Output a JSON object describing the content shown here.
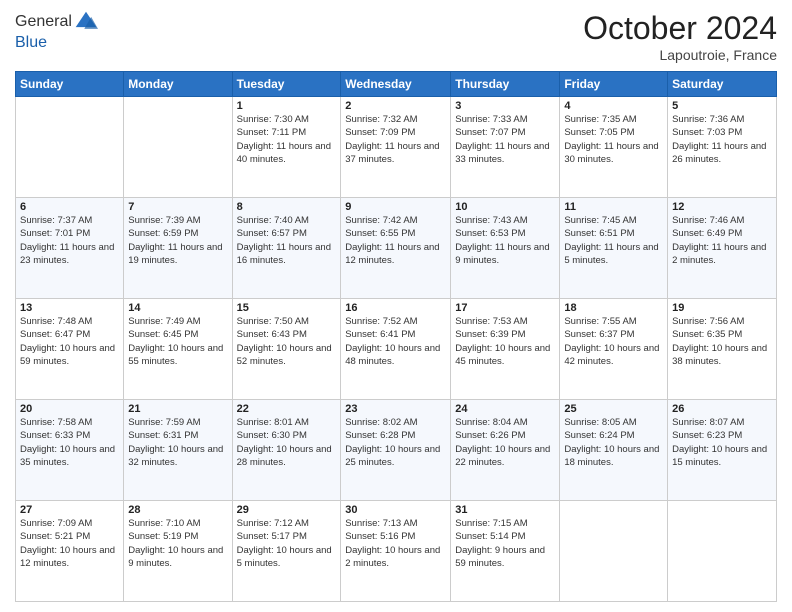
{
  "header": {
    "logo_line1": "General",
    "logo_line2": "Blue",
    "month_title": "October 2024",
    "location": "Lapoutroie, France"
  },
  "weekdays": [
    "Sunday",
    "Monday",
    "Tuesday",
    "Wednesday",
    "Thursday",
    "Friday",
    "Saturday"
  ],
  "weeks": [
    [
      {
        "day": "",
        "sunrise": "",
        "sunset": "",
        "daylight": ""
      },
      {
        "day": "",
        "sunrise": "",
        "sunset": "",
        "daylight": ""
      },
      {
        "day": "1",
        "sunrise": "Sunrise: 7:30 AM",
        "sunset": "Sunset: 7:11 PM",
        "daylight": "Daylight: 11 hours and 40 minutes."
      },
      {
        "day": "2",
        "sunrise": "Sunrise: 7:32 AM",
        "sunset": "Sunset: 7:09 PM",
        "daylight": "Daylight: 11 hours and 37 minutes."
      },
      {
        "day": "3",
        "sunrise": "Sunrise: 7:33 AM",
        "sunset": "Sunset: 7:07 PM",
        "daylight": "Daylight: 11 hours and 33 minutes."
      },
      {
        "day": "4",
        "sunrise": "Sunrise: 7:35 AM",
        "sunset": "Sunset: 7:05 PM",
        "daylight": "Daylight: 11 hours and 30 minutes."
      },
      {
        "day": "5",
        "sunrise": "Sunrise: 7:36 AM",
        "sunset": "Sunset: 7:03 PM",
        "daylight": "Daylight: 11 hours and 26 minutes."
      }
    ],
    [
      {
        "day": "6",
        "sunrise": "Sunrise: 7:37 AM",
        "sunset": "Sunset: 7:01 PM",
        "daylight": "Daylight: 11 hours and 23 minutes."
      },
      {
        "day": "7",
        "sunrise": "Sunrise: 7:39 AM",
        "sunset": "Sunset: 6:59 PM",
        "daylight": "Daylight: 11 hours and 19 minutes."
      },
      {
        "day": "8",
        "sunrise": "Sunrise: 7:40 AM",
        "sunset": "Sunset: 6:57 PM",
        "daylight": "Daylight: 11 hours and 16 minutes."
      },
      {
        "day": "9",
        "sunrise": "Sunrise: 7:42 AM",
        "sunset": "Sunset: 6:55 PM",
        "daylight": "Daylight: 11 hours and 12 minutes."
      },
      {
        "day": "10",
        "sunrise": "Sunrise: 7:43 AM",
        "sunset": "Sunset: 6:53 PM",
        "daylight": "Daylight: 11 hours and 9 minutes."
      },
      {
        "day": "11",
        "sunrise": "Sunrise: 7:45 AM",
        "sunset": "Sunset: 6:51 PM",
        "daylight": "Daylight: 11 hours and 5 minutes."
      },
      {
        "day": "12",
        "sunrise": "Sunrise: 7:46 AM",
        "sunset": "Sunset: 6:49 PM",
        "daylight": "Daylight: 11 hours and 2 minutes."
      }
    ],
    [
      {
        "day": "13",
        "sunrise": "Sunrise: 7:48 AM",
        "sunset": "Sunset: 6:47 PM",
        "daylight": "Daylight: 10 hours and 59 minutes."
      },
      {
        "day": "14",
        "sunrise": "Sunrise: 7:49 AM",
        "sunset": "Sunset: 6:45 PM",
        "daylight": "Daylight: 10 hours and 55 minutes."
      },
      {
        "day": "15",
        "sunrise": "Sunrise: 7:50 AM",
        "sunset": "Sunset: 6:43 PM",
        "daylight": "Daylight: 10 hours and 52 minutes."
      },
      {
        "day": "16",
        "sunrise": "Sunrise: 7:52 AM",
        "sunset": "Sunset: 6:41 PM",
        "daylight": "Daylight: 10 hours and 48 minutes."
      },
      {
        "day": "17",
        "sunrise": "Sunrise: 7:53 AM",
        "sunset": "Sunset: 6:39 PM",
        "daylight": "Daylight: 10 hours and 45 minutes."
      },
      {
        "day": "18",
        "sunrise": "Sunrise: 7:55 AM",
        "sunset": "Sunset: 6:37 PM",
        "daylight": "Daylight: 10 hours and 42 minutes."
      },
      {
        "day": "19",
        "sunrise": "Sunrise: 7:56 AM",
        "sunset": "Sunset: 6:35 PM",
        "daylight": "Daylight: 10 hours and 38 minutes."
      }
    ],
    [
      {
        "day": "20",
        "sunrise": "Sunrise: 7:58 AM",
        "sunset": "Sunset: 6:33 PM",
        "daylight": "Daylight: 10 hours and 35 minutes."
      },
      {
        "day": "21",
        "sunrise": "Sunrise: 7:59 AM",
        "sunset": "Sunset: 6:31 PM",
        "daylight": "Daylight: 10 hours and 32 minutes."
      },
      {
        "day": "22",
        "sunrise": "Sunrise: 8:01 AM",
        "sunset": "Sunset: 6:30 PM",
        "daylight": "Daylight: 10 hours and 28 minutes."
      },
      {
        "day": "23",
        "sunrise": "Sunrise: 8:02 AM",
        "sunset": "Sunset: 6:28 PM",
        "daylight": "Daylight: 10 hours and 25 minutes."
      },
      {
        "day": "24",
        "sunrise": "Sunrise: 8:04 AM",
        "sunset": "Sunset: 6:26 PM",
        "daylight": "Daylight: 10 hours and 22 minutes."
      },
      {
        "day": "25",
        "sunrise": "Sunrise: 8:05 AM",
        "sunset": "Sunset: 6:24 PM",
        "daylight": "Daylight: 10 hours and 18 minutes."
      },
      {
        "day": "26",
        "sunrise": "Sunrise: 8:07 AM",
        "sunset": "Sunset: 6:23 PM",
        "daylight": "Daylight: 10 hours and 15 minutes."
      }
    ],
    [
      {
        "day": "27",
        "sunrise": "Sunrise: 7:09 AM",
        "sunset": "Sunset: 5:21 PM",
        "daylight": "Daylight: 10 hours and 12 minutes."
      },
      {
        "day": "28",
        "sunrise": "Sunrise: 7:10 AM",
        "sunset": "Sunset: 5:19 PM",
        "daylight": "Daylight: 10 hours and 9 minutes."
      },
      {
        "day": "29",
        "sunrise": "Sunrise: 7:12 AM",
        "sunset": "Sunset: 5:17 PM",
        "daylight": "Daylight: 10 hours and 5 minutes."
      },
      {
        "day": "30",
        "sunrise": "Sunrise: 7:13 AM",
        "sunset": "Sunset: 5:16 PM",
        "daylight": "Daylight: 10 hours and 2 minutes."
      },
      {
        "day": "31",
        "sunrise": "Sunrise: 7:15 AM",
        "sunset": "Sunset: 5:14 PM",
        "daylight": "Daylight: 9 hours and 59 minutes."
      },
      {
        "day": "",
        "sunrise": "",
        "sunset": "",
        "daylight": ""
      },
      {
        "day": "",
        "sunrise": "",
        "sunset": "",
        "daylight": ""
      }
    ]
  ]
}
